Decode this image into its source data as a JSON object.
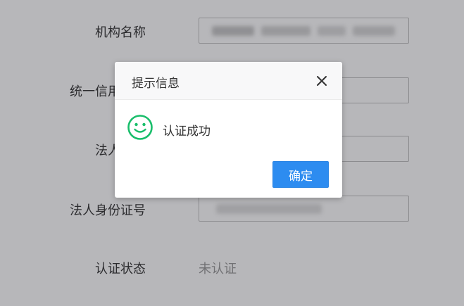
{
  "form": {
    "fields": [
      {
        "label": "机构名称"
      },
      {
        "label": "统一信用代码"
      },
      {
        "label": "法人名称"
      },
      {
        "label": "法人身份证号"
      }
    ],
    "status": {
      "label": "认证状态",
      "value": "未认证"
    }
  },
  "dialog": {
    "title": "提示信息",
    "message": "认证成功",
    "confirm_label": "确定",
    "icons": {
      "close": "close-icon",
      "status": "smile-icon"
    },
    "colors": {
      "primary": "#2d8cf0",
      "success": "#19be6b"
    }
  }
}
